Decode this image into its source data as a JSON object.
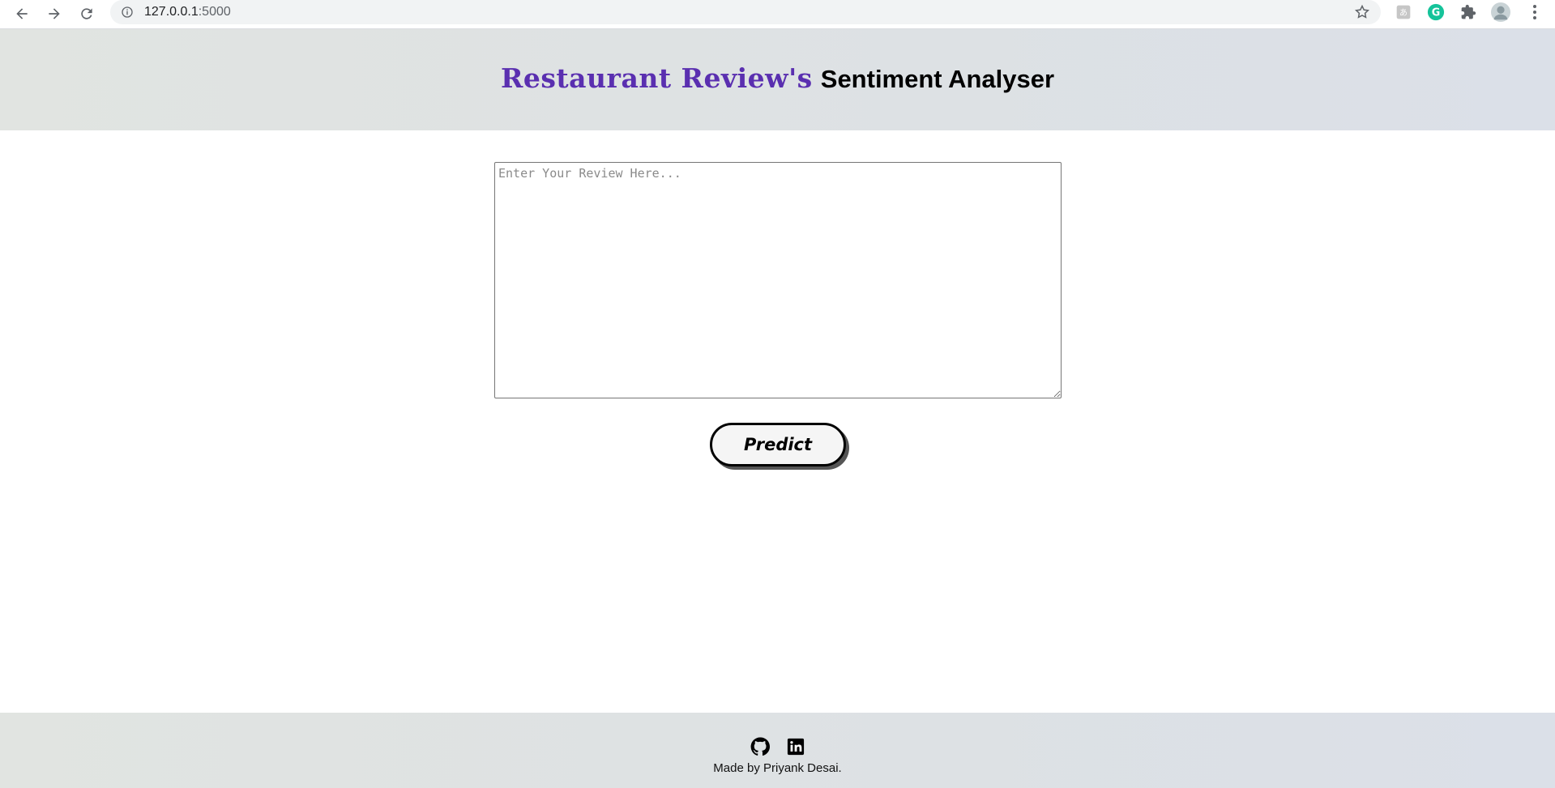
{
  "browser": {
    "url_host": "127.0.0.1",
    "url_port": ":5000"
  },
  "header": {
    "title_accent": "Restaurant Review's",
    "title_rest": "Sentiment Analyser"
  },
  "main": {
    "review_placeholder": "Enter Your Review Here...",
    "predict_label": "Predict"
  },
  "footer": {
    "credit": "Made by Priyank Desai.",
    "links": [
      {
        "icon": "github-icon"
      },
      {
        "icon": "linkedin-icon"
      }
    ]
  },
  "colors": {
    "accent": "#5a2fb0",
    "header_bg": "#e0e3e3"
  }
}
